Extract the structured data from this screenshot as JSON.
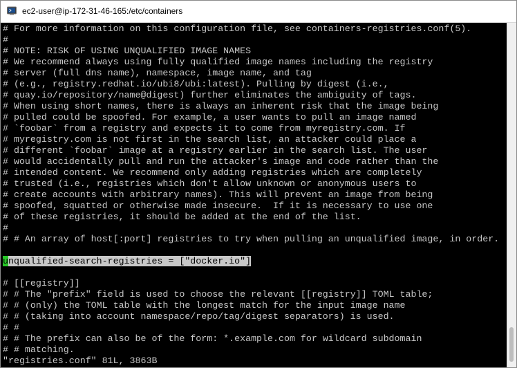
{
  "window": {
    "title": "ec2-user@ip-172-31-46-165:/etc/containers",
    "app_icon": "putty-terminal-icon"
  },
  "terminal": {
    "lines": [
      "# For more information on this configuration file, see containers-registries.conf(5).",
      "#",
      "# NOTE: RISK OF USING UNQUALIFIED IMAGE NAMES",
      "# We recommend always using fully qualified image names including the registry",
      "# server (full dns name), namespace, image name, and tag",
      "# (e.g., registry.redhat.io/ubi8/ubi:latest). Pulling by digest (i.e.,",
      "# quay.io/repository/name@digest) further eliminates the ambiguity of tags.",
      "# When using short names, there is always an inherent risk that the image being",
      "# pulled could be spoofed. For example, a user wants to pull an image named",
      "# `foobar` from a registry and expects it to come from myregistry.com. If",
      "# myregistry.com is not first in the search list, an attacker could place a",
      "# different `foobar` image at a registry earlier in the search list. The user",
      "# would accidentally pull and run the attacker's image and code rather than the",
      "# intended content. We recommend only adding registries which are completely",
      "# trusted (i.e., registries which don't allow unknown or anonymous users to",
      "# create accounts with arbitrary names). This will prevent an image from being",
      "# spoofed, squatted or otherwise made insecure.  If it is necessary to use one",
      "# of these registries, it should be added at the end of the list.",
      "#",
      "# # An array of host[:port] registries to try when pulling an unqualified image, in order.",
      "",
      "",
      "",
      "# [[registry]]",
      "# # The \"prefix\" field is used to choose the relevant [[registry]] TOML table;",
      "# # (only) the TOML table with the longest match for the input image name",
      "# # (taking into account namespace/repo/tag/digest separators) is used.",
      "# #",
      "# # The prefix can also be of the form: *.example.com for wildcard subdomain",
      "# # matching.",
      "\"registries.conf\" 81L, 3863B"
    ],
    "highlighted_line": {
      "cursor_char": "u",
      "rest": "nqualified-search-registries = [\"docker.io\"]"
    }
  }
}
